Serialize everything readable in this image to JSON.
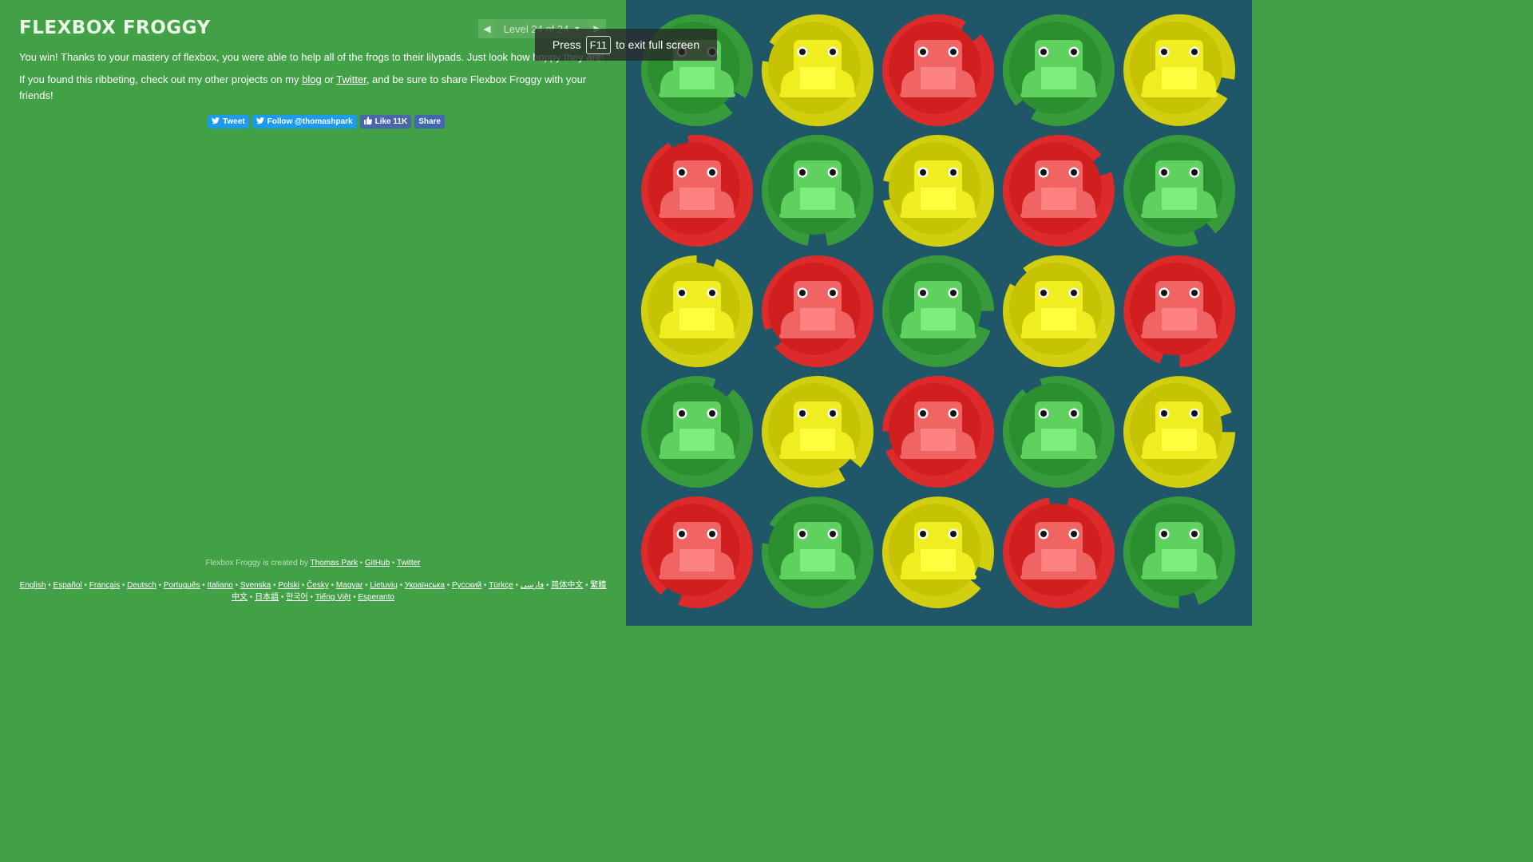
{
  "app": {
    "title": "FLEXBOX FROGGY"
  },
  "level_nav": {
    "prev_icon": "◀",
    "level_label": "Level 24 of 24",
    "dropdown_icon": "▼",
    "next_icon": "▶"
  },
  "instructions": {
    "win_text": "You win! Thanks to your mastery of flexbox, you were able to help all of the frogs to their lilypads. Just look how hoppy they are!",
    "projects_prefix": "If you found this ribbeting, check out my other projects on my",
    "blog_link": "blog",
    "or_text": "or",
    "twitter_link": "Twitter",
    "projects_suffix": ", and be sure to share Flexbox Froggy with your friends!"
  },
  "share": {
    "tweet": "Tweet",
    "follow": "Follow @thomashpark",
    "like": "Like 11K",
    "share": "Share"
  },
  "credits": {
    "prefix": "Flexbox Froggy is created by",
    "author": "Thomas Park",
    "github": "GitHub",
    "twitter": "Twitter"
  },
  "languages": [
    "English",
    "Español",
    "Français",
    "Deutsch",
    "Português",
    "Italiano",
    "Svenska",
    "Polski",
    "Česky",
    "Magyar",
    "Lietuvių",
    "Українська",
    "Русский",
    "Türkçe",
    "فارسی",
    "简体中文",
    "繁體中文",
    "日本語",
    "한국어",
    "Tiếng Việt",
    "Esperanto"
  ],
  "toast": {
    "press": "Press",
    "key": "F11",
    "message": "to exit full screen"
  },
  "colors": {
    "pond": "#1f5768",
    "green_pad": "#2b8f2f",
    "green_frog": "#5fd15f",
    "yellow_pad": "#c6c204",
    "yellow_frog": "#f0ee21",
    "red_pad": "#d11f1f",
    "red_frog": "#f06464"
  },
  "board": {
    "rows": [
      [
        "green",
        "yellow",
        "red",
        "green",
        "yellow"
      ],
      [
        "red",
        "green",
        "yellow",
        "red",
        "green"
      ],
      [
        "yellow",
        "red",
        "green",
        "yellow",
        "red"
      ],
      [
        "green",
        "yellow",
        "red",
        "green",
        "yellow"
      ],
      [
        "red",
        "green",
        "yellow",
        "red",
        "green"
      ]
    ]
  }
}
